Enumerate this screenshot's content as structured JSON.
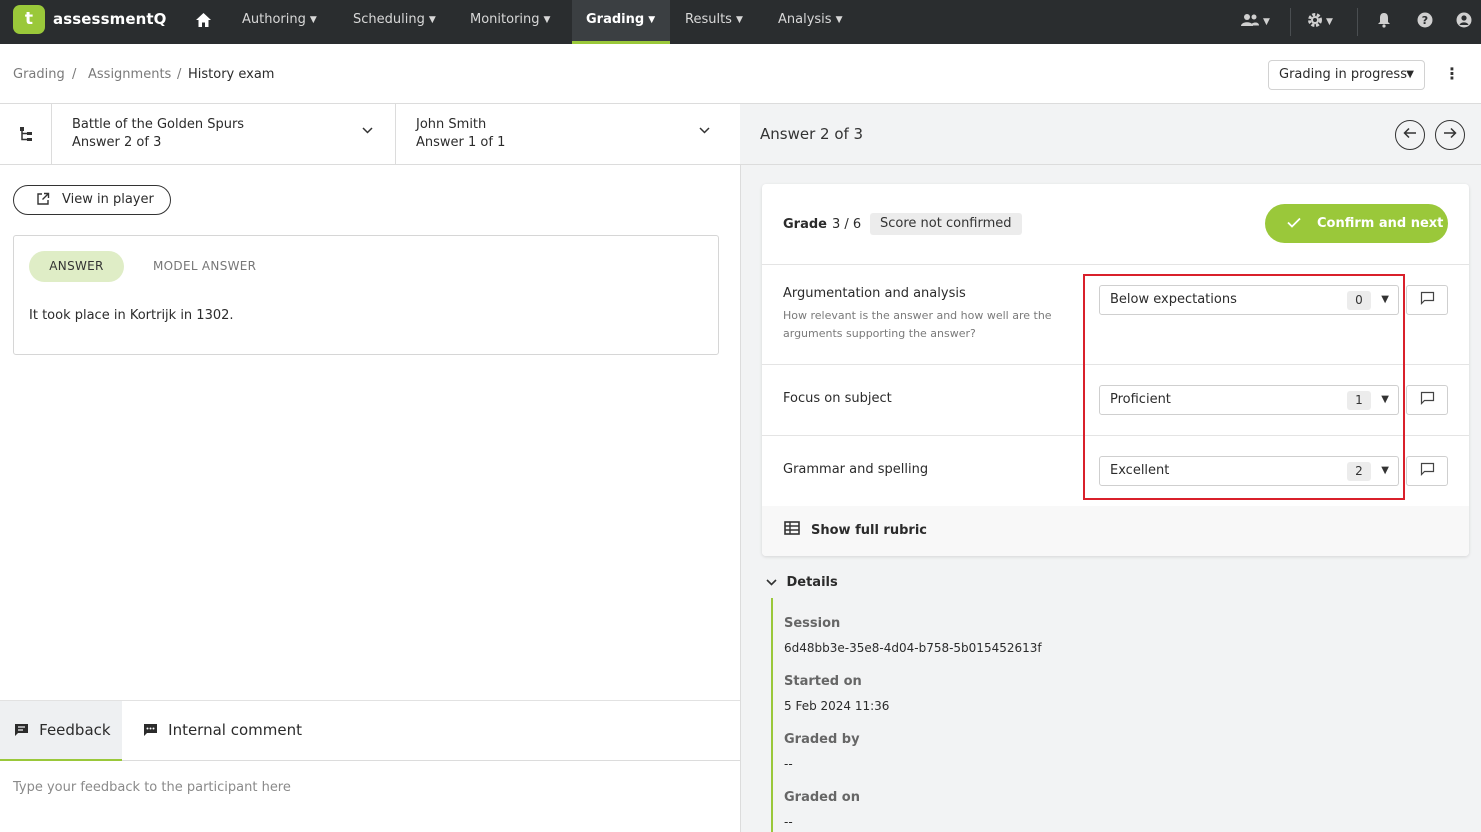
{
  "app": {
    "logo_letter": "t",
    "name": "assessmentQ",
    "brand_color": "#9ac83a"
  },
  "nav": {
    "items": [
      {
        "label": "Authoring"
      },
      {
        "label": "Scheduling"
      },
      {
        "label": "Monitoring"
      },
      {
        "label": "Grading"
      },
      {
        "label": "Results"
      },
      {
        "label": "Analysis"
      }
    ],
    "active": "Grading",
    "icons": [
      "home-icon",
      "users-icon",
      "gear-icon",
      "bell-icon",
      "help-icon",
      "account-icon"
    ]
  },
  "breadcrumb": [
    {
      "label": "Grading"
    },
    {
      "label": "Assignments"
    },
    {
      "label": "History exam"
    }
  ],
  "status_select": {
    "value": "Grading in progress"
  },
  "question_selector": {
    "title": "Battle of the Golden Spurs",
    "subtitle": "Answer 2 of 3"
  },
  "participant_selector": {
    "name": "John Smith",
    "subtitle": "Answer 1 of 1"
  },
  "view_player": {
    "label": "View in player"
  },
  "answer_card": {
    "tab_answer": "ANSWER",
    "tab_model": "MODEL ANSWER",
    "answer_text": "It took place in Kortrijk in 1302."
  },
  "feedback": {
    "tab_feedback": "Feedback",
    "tab_internal": "Internal comment",
    "placeholder": "Type your feedback to the participant here"
  },
  "answer_header": {
    "title": "Answer 2 of 3"
  },
  "grade": {
    "label": "Grade",
    "value": "3 / 6",
    "status": "Score not confirmed",
    "confirm_label": "Confirm and next"
  },
  "criteria": [
    {
      "name": "Argumentation and analysis",
      "description": "How relevant is the answer and how well are the arguments supporting the answer?",
      "level": "Below expectations",
      "score": "0"
    },
    {
      "name": "Focus on subject",
      "description": "",
      "level": "Proficient",
      "score": "1"
    },
    {
      "name": "Grammar and spelling",
      "description": "",
      "level": "Excellent",
      "score": "2"
    }
  ],
  "rubric": {
    "label": "Show full rubric"
  },
  "details": {
    "label": "Details",
    "fields": [
      {
        "label": "Session",
        "value": "6d48bb3e-35e8-4d04-b758-5b015452613f"
      },
      {
        "label": "Started on",
        "value": "5 Feb 2024 11:36"
      },
      {
        "label": "Graded by",
        "value": "--"
      },
      {
        "label": "Graded on",
        "value": "--"
      }
    ]
  },
  "highlight_color": "#d9202b"
}
